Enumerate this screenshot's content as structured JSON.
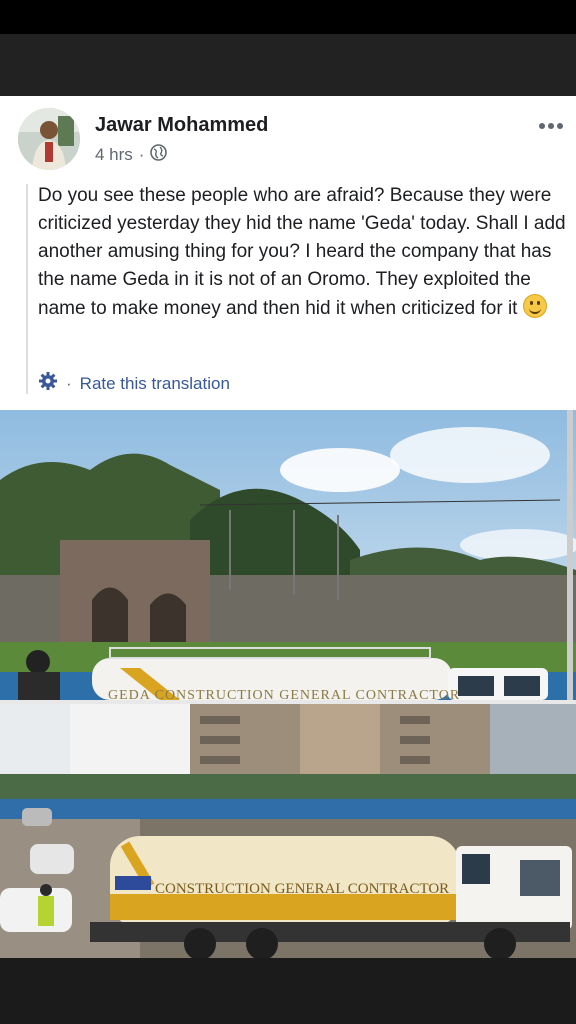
{
  "post": {
    "author": "Jawar Mohammed",
    "time": "4 hrs",
    "visibility_icon": "globe-icon",
    "more_icon": "more-options-icon",
    "text": "Do you see these people who are afraid? Because they were criticized yesterday they hid the name 'Geda' today. Shall I add another amusing thing for you? I heard the company that has the name Geda in it is not of an Oromo. They exploited the name to make money and then hid it when criticized for it",
    "translation_link": "Rate this translation",
    "colors": {
      "link": "#385898",
      "muted": "#606770",
      "text": "#1c1e21"
    }
  },
  "photos": {
    "top_truck_text": "GEDA CONSTRUCTION GENERAL CONTRACTOR",
    "bottom_truck_text": "CONSTRUCTION GENERAL CONTRACTOR"
  }
}
